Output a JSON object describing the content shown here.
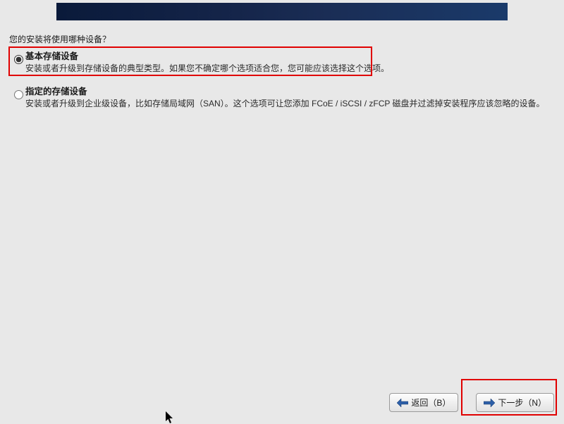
{
  "prompt": "您的安装将使用哪种设备？",
  "options": [
    {
      "id": "basic",
      "title": "基本存储设备",
      "desc": "安装或者升级到存储设备的典型类型。如果您不确定哪个选项适合您，您可能应该选择这个选项。",
      "selected": true
    },
    {
      "id": "specialized",
      "title": "指定的存储设备",
      "desc": "安装或者升级到企业级设备，比如存储局域网（SAN）。这个选项可让您添加 FCoE / iSCSI / zFCP 磁盘并过滤掉安装程序应该忽略的设备。",
      "selected": false
    }
  ],
  "buttons": {
    "back": "返回（B）",
    "next": "下一步（N）"
  }
}
